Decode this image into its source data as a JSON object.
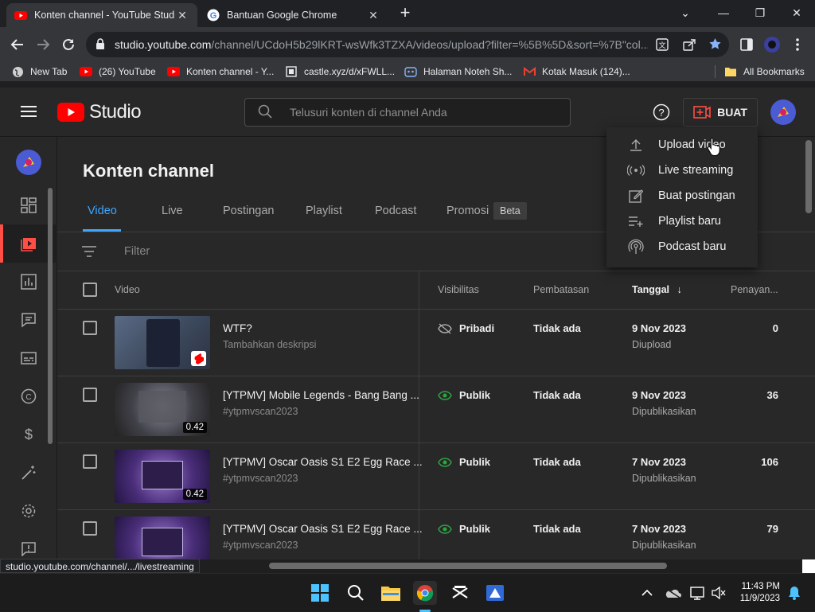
{
  "browser": {
    "tabs": [
      {
        "title": "Konten channel - YouTube Studio",
        "close": "✕"
      },
      {
        "title": "Bantuan Google Chrome",
        "close": "✕"
      }
    ],
    "new_tab": "+",
    "window": {
      "minimize": "⌄",
      "min": "—",
      "restore": "❐",
      "close": "✕"
    },
    "url_host": "studio.youtube.com",
    "url_path": "/channel/UCdoH5b29lKRT-wsWfk3TZXA/videos/upload?filter=%5B%5D&sort=%7B\"col...",
    "bookmarks": [
      {
        "label": "New Tab"
      },
      {
        "label": "(26) YouTube"
      },
      {
        "label": "Konten channel - Y..."
      },
      {
        "label": "castle.xyz/d/xFWLL..."
      },
      {
        "label": "Halaman Noteh Sh..."
      },
      {
        "label": "Kotak Masuk (124)..."
      },
      {
        "label": "All Bookmarks"
      }
    ],
    "status_url": "studio.youtube.com/channel/.../livestreaming"
  },
  "studio": {
    "logo_text": "Studio",
    "search_placeholder": "Telusuri konten di channel Anda",
    "create_label": "BUAT",
    "page_title": "Konten channel",
    "tabs": [
      "Video",
      "Live",
      "Postingan",
      "Playlist",
      "Podcast",
      "Promosi"
    ],
    "beta_badge": "Beta",
    "filter_placeholder": "Filter",
    "columns": {
      "video": "Video",
      "visibility": "Visibilitas",
      "restrictions": "Pembatasan",
      "date": "Tanggal",
      "views": "Penayan..."
    },
    "rows": [
      {
        "title": "WTF?",
        "desc": "Tambahkan deskripsi",
        "visibility": "Pribadi",
        "visibility_icon": "eye-off-icon",
        "restriction": "Tidak ada",
        "date": "9 Nov 2023",
        "date_status": "Diupload",
        "views": "0",
        "duration": ""
      },
      {
        "title": "[YTPMV] Mobile Legends - Bang Bang ...",
        "desc": "#ytpmvscan2023",
        "visibility": "Publik",
        "visibility_icon": "eye-icon",
        "restriction": "Tidak ada",
        "date": "9 Nov 2023",
        "date_status": "Dipublikasikan",
        "views": "36",
        "duration": "0.42"
      },
      {
        "title": "[YTPMV] Oscar Oasis S1 E2 Egg Race ...",
        "desc": "#ytpmvscan2023",
        "visibility": "Publik",
        "visibility_icon": "eye-icon",
        "restriction": "Tidak ada",
        "date": "7 Nov 2023",
        "date_status": "Dipublikasikan",
        "views": "106",
        "duration": "0.42"
      },
      {
        "title": "[YTPMV] Oscar Oasis S1 E2 Egg Race ...",
        "desc": "#ytpmvscan2023",
        "visibility": "Publik",
        "visibility_icon": "eye-icon",
        "restriction": "Tidak ada",
        "date": "7 Nov 2023",
        "date_status": "Dipublikasikan",
        "views": "79",
        "duration": ""
      }
    ],
    "create_menu": [
      "Upload video",
      "Live streaming",
      "Buat postingan",
      "Playlist baru",
      "Podcast baru"
    ]
  },
  "taskbar": {
    "time": "11:43 PM",
    "date": "11/9/2023"
  },
  "colors": {
    "accent_blue": "#3ea6ff",
    "youtube_red": "#ff0000",
    "public_green": "#2ba640"
  }
}
